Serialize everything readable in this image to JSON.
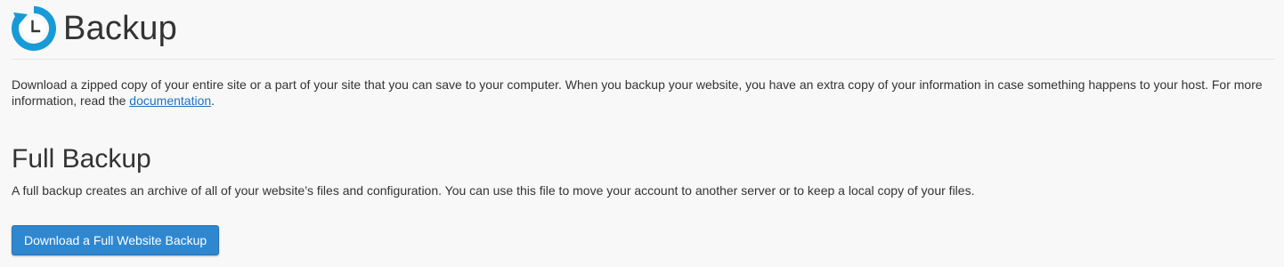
{
  "header": {
    "title": "Backup",
    "icon": "backup-clock-icon",
    "icon_color": "#179bd7"
  },
  "intro": {
    "text_before_link": "Download a zipped copy of your entire site or a part of your site that you can save to your computer. When you backup your website, you have an extra copy of your information in case something happens to your host. For more information, read the ",
    "link_text": "documentation",
    "text_after_link": "."
  },
  "full_backup": {
    "title": "Full Backup",
    "description": "A full backup creates an archive of all of your website’s files and configuration. You can use this file to move your account to another server or to keep a local copy of your files.",
    "button_label": "Download a Full Website Backup",
    "button_color": "#2f87d0"
  }
}
